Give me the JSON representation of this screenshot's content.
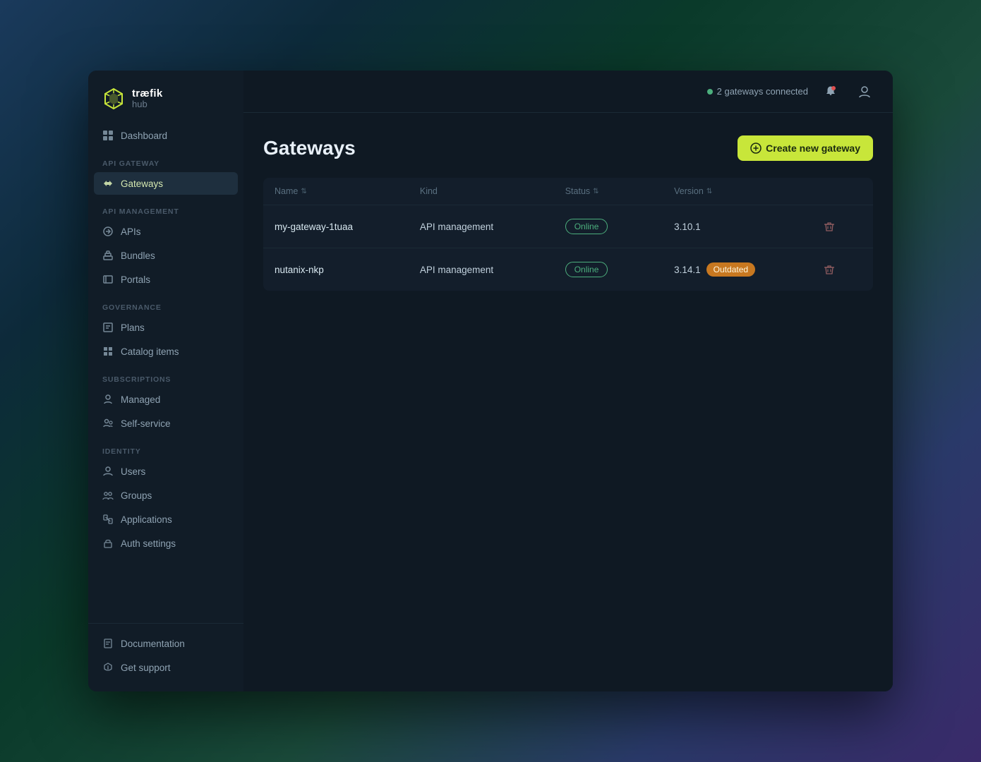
{
  "app": {
    "logo_brand": "træfik",
    "logo_sub": "hub"
  },
  "topbar": {
    "gateways_connected": "2 gateways connected",
    "status_dot_color": "#4caf7d"
  },
  "sidebar": {
    "sections": [
      {
        "label": null,
        "items": [
          {
            "id": "dashboard",
            "label": "Dashboard",
            "icon": "dashboard"
          }
        ]
      },
      {
        "label": "API GATEWAY",
        "items": [
          {
            "id": "gateways",
            "label": "Gateways",
            "icon": "gateways",
            "active": true
          }
        ]
      },
      {
        "label": "API MANAGEMENT",
        "items": [
          {
            "id": "apis",
            "label": "APIs",
            "icon": "apis"
          },
          {
            "id": "bundles",
            "label": "Bundles",
            "icon": "bundles"
          },
          {
            "id": "portals",
            "label": "Portals",
            "icon": "portals"
          }
        ]
      },
      {
        "label": "GOVERNANCE",
        "items": [
          {
            "id": "plans",
            "label": "Plans",
            "icon": "plans"
          },
          {
            "id": "catalog-items",
            "label": "Catalog items",
            "icon": "catalog"
          }
        ]
      },
      {
        "label": "SUBSCRIPTIONS",
        "items": [
          {
            "id": "managed",
            "label": "Managed",
            "icon": "managed"
          },
          {
            "id": "self-service",
            "label": "Self-service",
            "icon": "selfservice"
          }
        ]
      },
      {
        "label": "IDENTITY",
        "items": [
          {
            "id": "users",
            "label": "Users",
            "icon": "users"
          },
          {
            "id": "groups",
            "label": "Groups",
            "icon": "groups"
          },
          {
            "id": "applications",
            "label": "Applications",
            "icon": "applications"
          },
          {
            "id": "auth-settings",
            "label": "Auth settings",
            "icon": "authsettings"
          }
        ]
      }
    ],
    "bottom": [
      {
        "id": "documentation",
        "label": "Documentation",
        "icon": "documentation"
      },
      {
        "id": "get-support",
        "label": "Get support",
        "icon": "support"
      }
    ]
  },
  "page": {
    "title": "Gateways",
    "create_button": "Create new gateway"
  },
  "table": {
    "columns": [
      "Name",
      "Kind",
      "Status",
      "Version"
    ],
    "rows": [
      {
        "name": "my-gateway-1tuaa",
        "kind": "API management",
        "status": "Online",
        "version": "3.10.1",
        "outdated": false
      },
      {
        "name": "nutanix-nkp",
        "kind": "API management",
        "status": "Online",
        "version": "3.14.1",
        "outdated": true
      }
    ]
  }
}
